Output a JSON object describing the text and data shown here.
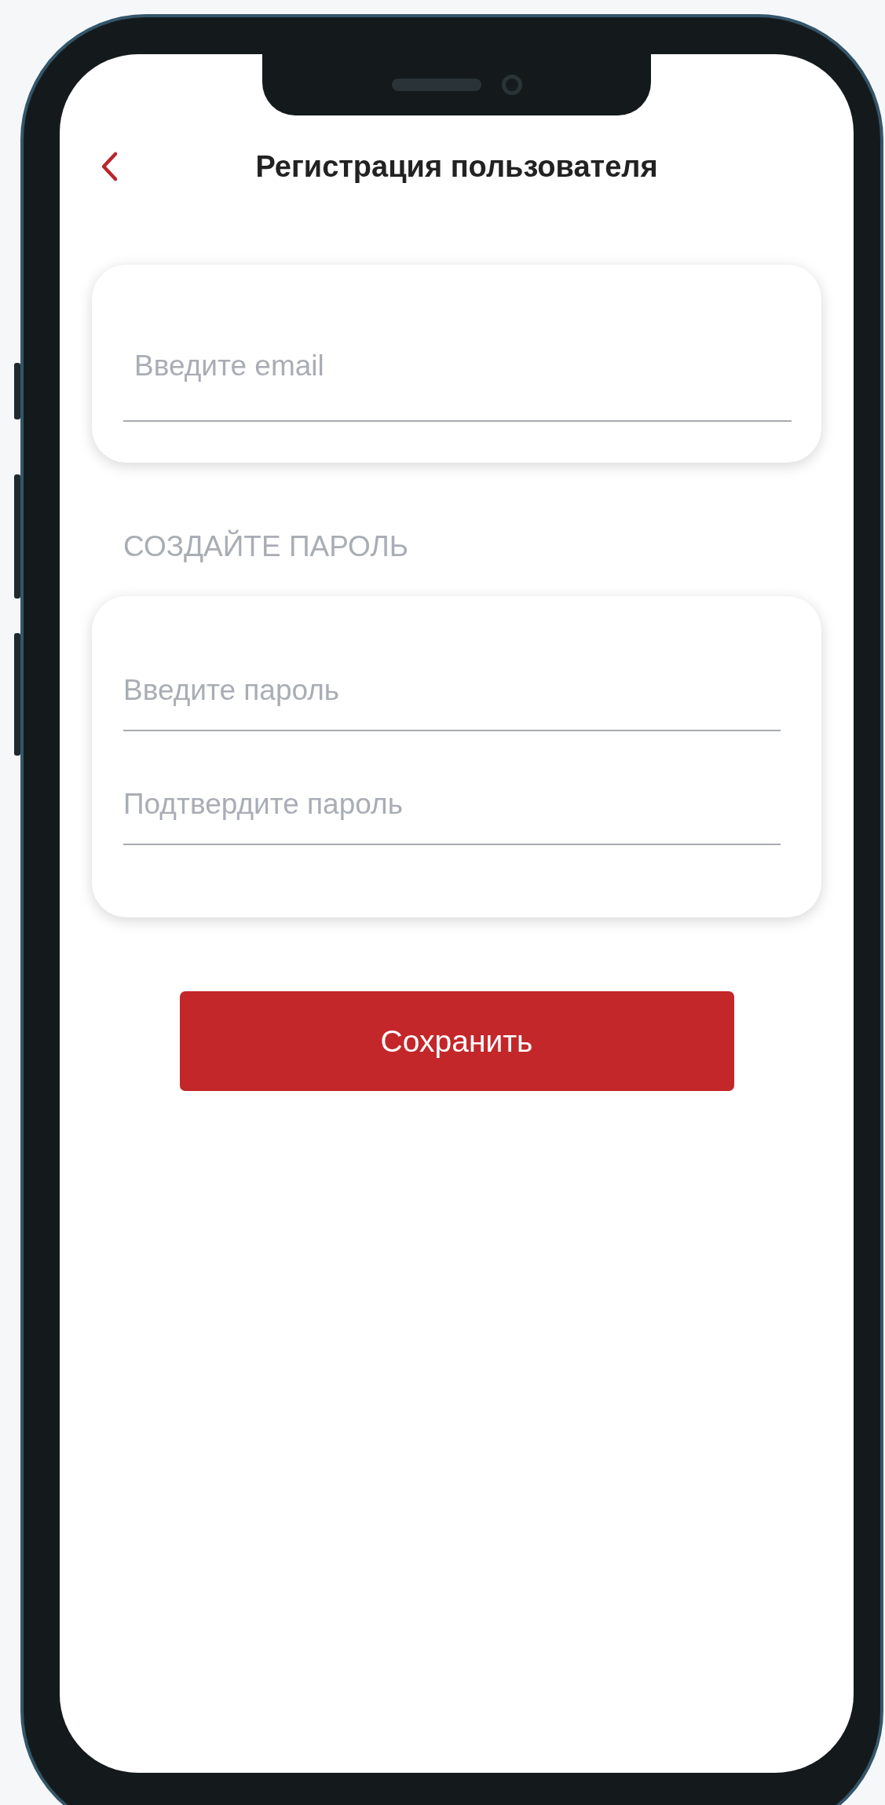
{
  "header": {
    "title": "Регистрация пользователя"
  },
  "email_card": {
    "fields": [
      {
        "placeholder": "Введите email"
      }
    ]
  },
  "password_section": {
    "label": "СОЗДАЙТЕ ПАРОЛЬ",
    "fields": [
      {
        "placeholder": "Введите пароль"
      },
      {
        "placeholder": "Подтвердите пароль"
      }
    ]
  },
  "save_button": {
    "label": "Сохранить"
  }
}
